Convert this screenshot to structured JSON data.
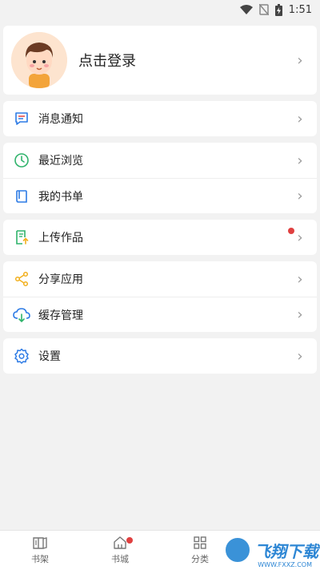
{
  "status_bar": {
    "time": "1:51"
  },
  "profile": {
    "login_label": "点击登录"
  },
  "menu_groups": [
    [
      {
        "label": "消息通知",
        "icon": "message-icon"
      }
    ],
    [
      {
        "label": "最近浏览",
        "icon": "clock-icon"
      },
      {
        "label": "我的书单",
        "icon": "book-list-icon"
      }
    ],
    [
      {
        "label": "上传作品",
        "icon": "upload-icon",
        "badge": true
      }
    ],
    [
      {
        "label": "分享应用",
        "icon": "share-icon"
      },
      {
        "label": "缓存管理",
        "icon": "cloud-download-icon"
      }
    ],
    [
      {
        "label": "设置",
        "icon": "gear-icon"
      }
    ]
  ],
  "tabs": [
    {
      "label": "书架",
      "icon": "bookshelf-icon"
    },
    {
      "label": "书城",
      "icon": "home-icon",
      "badge": true
    },
    {
      "label": "分类",
      "icon": "grid-icon"
    }
  ],
  "watermark": {
    "text": "飞翔下载",
    "url": "WWW.FXXZ.COM"
  },
  "colors": {
    "accent_red": "#e04040",
    "blue": "#2d7be5",
    "green": "#2fb36b",
    "yellow": "#f2b01e"
  }
}
